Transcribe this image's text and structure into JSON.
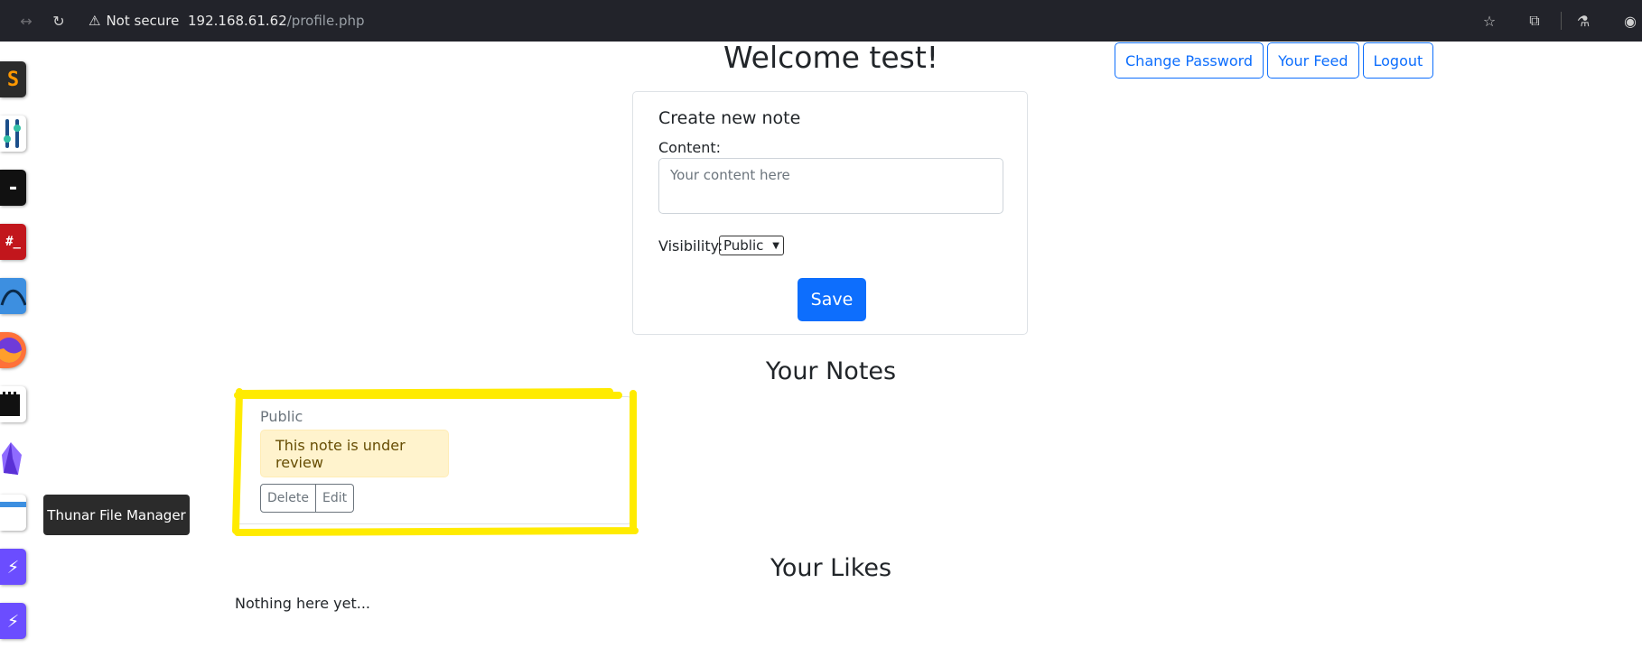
{
  "browser": {
    "security_label": "Not secure",
    "url_host": "192.168.61.62",
    "url_path": "/profile.php",
    "icons": [
      "back-icon",
      "forward-icon",
      "reload-icon",
      "warning-icon",
      "star-icon",
      "extensions-icon",
      "labs-icon",
      "profile-icon"
    ]
  },
  "dock": {
    "tooltip": "Thunar File Manager",
    "apps": [
      {
        "name": "sublime-text-icon",
        "glyph": "S",
        "bg": "#2b2b2b",
        "fg": "#ff9800"
      },
      {
        "name": "mixer-icon",
        "glyph": "",
        "bg": "#ffffff",
        "fg": "#1b4f8a"
      },
      {
        "name": "terminal-icon",
        "glyph": "-",
        "bg": "#111111",
        "fg": "#ffffff"
      },
      {
        "name": "root-terminal-icon",
        "glyph": "#_",
        "bg": "#c2161c",
        "fg": "#ffffff"
      },
      {
        "name": "wireshark-icon",
        "glyph": "",
        "bg": "#3d8fe0",
        "fg": "#ffffff"
      },
      {
        "name": "firefox-icon",
        "glyph": "",
        "bg": "#ff7139",
        "fg": "#ffffff"
      },
      {
        "name": "sd-card-icon",
        "glyph": "",
        "bg": "#ffffff",
        "fg": "#111111"
      },
      {
        "name": "obsidian-icon",
        "glyph": "",
        "bg": "#ffffff",
        "fg": "#7c4dff"
      },
      {
        "name": "file-manager-icon",
        "glyph": "",
        "bg": "#ffffff",
        "fg": "#3d8fe0"
      },
      {
        "name": "burp-icon-1",
        "glyph": "⚡",
        "bg": "#6b4dff",
        "fg": "#ffffff"
      },
      {
        "name": "burp-icon-2",
        "glyph": "⚡",
        "bg": "#6b4dff",
        "fg": "#ffffff"
      }
    ]
  },
  "page": {
    "welcome": "Welcome test!",
    "nav_buttons": {
      "change_password": "Change Password",
      "feed": "Your Feed",
      "logout": "Logout"
    },
    "create_card": {
      "title": "Create new note",
      "content_label": "Content:",
      "content_placeholder": "Your content here",
      "visibility_label": "Visibility:",
      "visibility_selected": "Public",
      "save_label": "Save"
    },
    "notes_heading": "Your Notes",
    "note": {
      "visibility": "Public",
      "status": "This note is under review",
      "delete_label": "Delete",
      "edit_label": "Edit"
    },
    "likes_heading": "Your Likes",
    "likes_empty": "Nothing here yet..."
  },
  "colors": {
    "primary": "#0d6efd",
    "highlight": "#ffeb00",
    "alert_bg": "#fff3cd"
  }
}
